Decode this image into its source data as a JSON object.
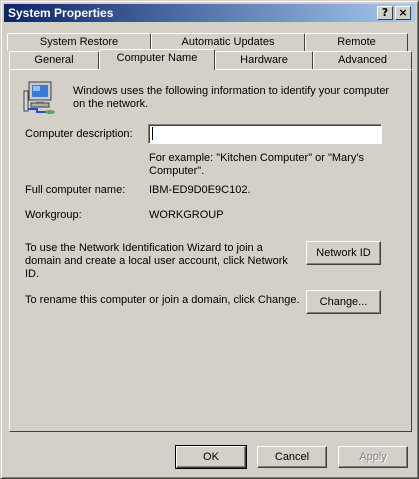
{
  "window": {
    "title": "System Properties",
    "help_button": "?",
    "close_button": "×"
  },
  "tabs": {
    "row_back": [
      "System Restore",
      "Automatic Updates",
      "Remote"
    ],
    "row_front": [
      "General",
      "Computer Name",
      "Hardware",
      "Advanced"
    ],
    "active": "Computer Name"
  },
  "computer_name_tab": {
    "intro": [
      "Windows uses the following information to identify your computer",
      "on the network."
    ],
    "description_label": "Computer description:",
    "description_value": "",
    "example": [
      "For example: \"Kitchen Computer\" or \"Mary's",
      "Computer\"."
    ],
    "full_name_label": "Full computer name:",
    "full_name_value": "IBM-ED9D0E9C102.",
    "workgroup_label": "Workgroup:",
    "workgroup_value": "WORKGROUP",
    "network_id_text": [
      "To use the Network Identification Wizard to join a",
      "domain and create a local user account, click Network",
      "ID."
    ],
    "network_id_button": "Network ID",
    "rename_text": "To rename this computer or join a domain, click Change.",
    "change_button": "Change..."
  },
  "footer": {
    "ok": "OK",
    "cancel": "Cancel",
    "apply": "Apply"
  },
  "icons": {
    "computer": "computer-network-icon"
  },
  "colors": {
    "titlebar_start": "#0a246a",
    "titlebar_end": "#a6caf0",
    "face": "#d4d0c8"
  }
}
